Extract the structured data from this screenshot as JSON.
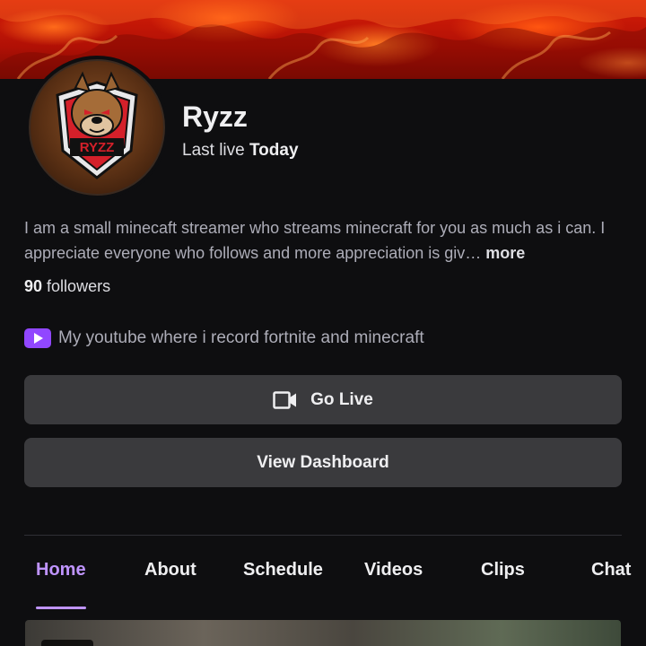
{
  "channel": {
    "name": "Ryzz",
    "last_live_prefix": "Last live",
    "last_live_value": "Today",
    "avatar_label": "RYZZ"
  },
  "about": {
    "bio": "I am a small minecaft streamer who streams minecraft for you as much as i can. I appreciate everyone who follows and more appreciation is giv…",
    "more_label": "more",
    "followers_count": "90",
    "followers_label": "followers"
  },
  "social": {
    "youtube_label": "My youtube where i record fortnite and minecraft",
    "icon": "youtube-icon"
  },
  "actions": {
    "go_live_label": "Go Live",
    "dashboard_label": "View Dashboard"
  },
  "tabs": [
    {
      "label": "Home",
      "active": true
    },
    {
      "label": "About",
      "active": false
    },
    {
      "label": "Schedule",
      "active": false
    },
    {
      "label": "Videos",
      "active": false
    },
    {
      "label": "Clips",
      "active": false
    },
    {
      "label": "Chat",
      "active": false
    }
  ],
  "colors": {
    "accent": "#bf94ff",
    "youtube_badge": "#9147ff",
    "background": "#0e0e10",
    "button": "#3a3a3d"
  }
}
